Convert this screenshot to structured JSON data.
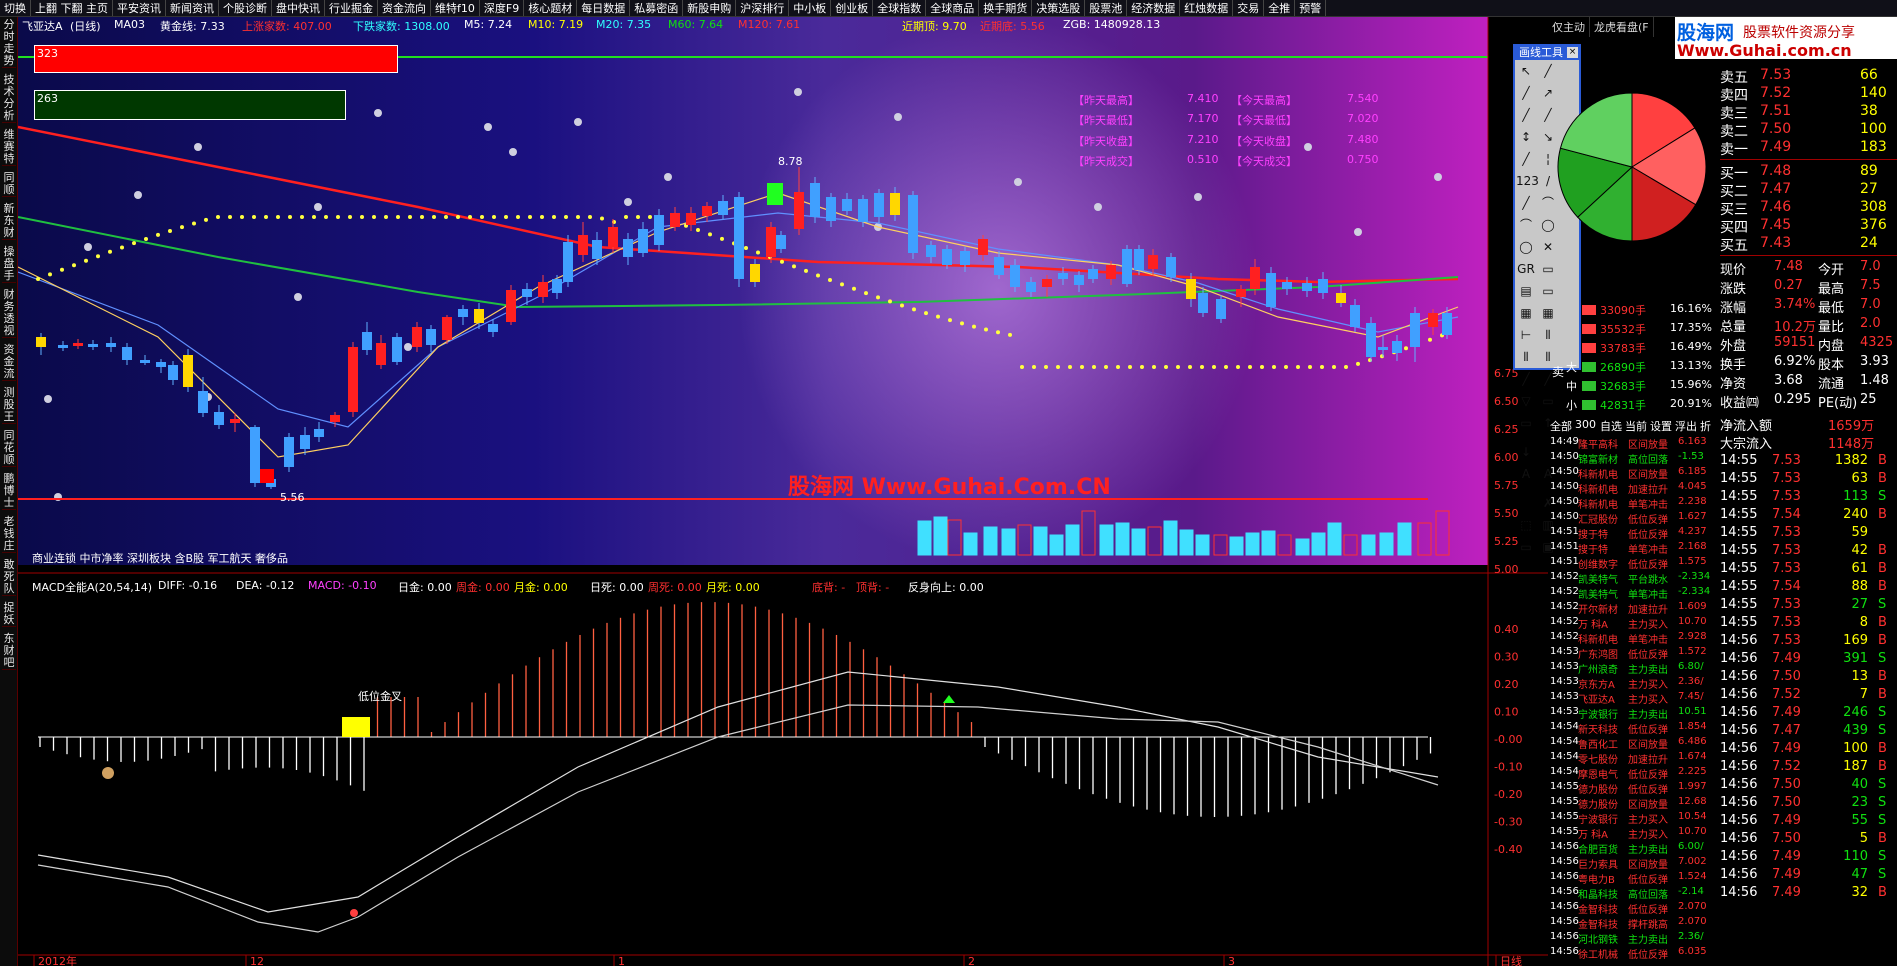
{
  "menubar": [
    "切换",
    "上翻 下翻 主页",
    "平安资讯",
    "新闻资讯",
    "个股诊断",
    "盘中快讯",
    "行业掘金",
    "资金流向",
    "维特f10",
    "深度F9",
    "核心题材",
    "每日数据",
    "私募密函",
    "新股申购",
    "沪深排行",
    "中小板",
    "创业板",
    "全球指数",
    "全球商品",
    "换手期货",
    "决策选股",
    "股票池",
    "经济数据",
    "红烛数据",
    "交易",
    "全推",
    "预警"
  ],
  "sidebar": [
    "分时走势",
    "技术分析",
    "维赛特",
    "同顺",
    "新东财",
    "操盘手",
    "财务透视",
    "资金流",
    "测股王",
    "同花顺",
    "鹏博士",
    "老钱庄",
    "敢死队",
    "捉妖",
    "东财吧"
  ],
  "header": {
    "stock": "飞亚达A",
    "period": "(日线)",
    "ma": "MA03",
    "gold_line": "黄金线: 7.33",
    "up_count": "上涨家数: 407.00",
    "down_count": "下跌家数: 1308.00",
    "m5": "M5: 7.24",
    "m10": "M10: 7.19",
    "m20": "M20: 7.35",
    "m60": "M60: 7.64",
    "m120": "M120: 7.61",
    "near_top": "近期顶: 9.70",
    "near_bottom": "近期底: 5.56",
    "zgb": "ZGB: 1480928.13"
  },
  "bars": {
    "red_value": "323",
    "green_value": "263"
  },
  "info": {
    "y_high_label": "【昨天最高】",
    "y_high": "7.410",
    "y_low_label": "【昨天最低】",
    "y_low": "7.170",
    "y_close_label": "【昨天收盘】",
    "y_close": "7.210",
    "y_vol_label": "【昨天成交】",
    "y_vol": "0.510",
    "t_high_label": "【今天最高】",
    "t_high": "7.540",
    "t_low_label": "【今天最低】",
    "t_low": "7.020",
    "t_close_label": "【今天收盘】",
    "t_close": "7.480",
    "t_vol_label": "【今天成交】",
    "t_vol": "0.750"
  },
  "annotations": {
    "high": "8.78",
    "low": "5.56",
    "watermark": "股海网 Www.Guhai.Com.CN",
    "golden_cross": "低位金叉"
  },
  "concepts": "商业连锁 中市净率 深圳板块 含B股 军工航天 奢侈品",
  "macd_header": {
    "name": "MACD全能A(20,54,14)",
    "diff": "DIFF: -0.16",
    "dea": "DEA: -0.12",
    "macd": "MACD: -0.10",
    "day_gold": "日金: 0.00",
    "week_gold": "周金: 0.00",
    "month_gold": "月金: 0.00",
    "day_dead": "日死: 0.00",
    "week_dead": "周死: 0.00",
    "month_dead": "月死: 0.00",
    "bottom_div": "底背: -",
    "top_div": "顶背: -",
    "rebound": "反身向上: 0.00"
  },
  "price_axis": [
    "6.75",
    "6.50",
    "6.25",
    "6.00",
    "5.75",
    "5.50",
    "5.25",
    "5.00"
  ],
  "macd_axis": [
    "0.40",
    "0.30",
    "0.20",
    "0.10",
    "-0.00",
    "-0.10",
    "-0.20",
    "-0.30",
    "-0.40"
  ],
  "time_axis": [
    "2012年",
    "12",
    "1",
    "2",
    "3",
    "日线"
  ],
  "toolbox": {
    "title": "画线工具",
    "close": "×",
    "glyphs": [
      "↖",
      "╱",
      "╱",
      "↗",
      "╱",
      "╱",
      "↕",
      "↘",
      "╱",
      "¦",
      "123",
      "/",
      "╱",
      "⌒",
      "⌒",
      "◯",
      "◯",
      "✕",
      "GR",
      "▭",
      "▤",
      "▭",
      "▦",
      "▦",
      "⊢",
      "⦀",
      "⦀",
      "⦀",
      "╱",
      "╱",
      "▽",
      "▭",
      "▭",
      "↑",
      "↓",
      "",
      "A",
      "A",
      "",
      "✗",
      "⬚",
      "▥",
      "▭",
      "▣",
      ""
    ]
  },
  "right_tabs": [
    "仅主动",
    "龙虎看盘(F"
  ],
  "logo": {
    "site": "股海网",
    "slogan": "股票软件资源分享",
    "url": "Www.Guhai.com.cn"
  },
  "orderbook": {
    "sells": [
      {
        "label": "卖五",
        "price": "7.53",
        "vol": "66"
      },
      {
        "label": "卖四",
        "price": "7.52",
        "vol": "140"
      },
      {
        "label": "卖三",
        "price": "7.51",
        "vol": "38"
      },
      {
        "label": "卖二",
        "price": "7.50",
        "vol": "100"
      },
      {
        "label": "卖一",
        "price": "7.49",
        "vol": "183"
      }
    ],
    "buys": [
      {
        "label": "买一",
        "price": "7.48",
        "vol": "89"
      },
      {
        "label": "买二",
        "price": "7.47",
        "vol": "27"
      },
      {
        "label": "买三",
        "price": "7.46",
        "vol": "308"
      },
      {
        "label": "买四",
        "price": "7.45",
        "vol": "376"
      },
      {
        "label": "买五",
        "price": "7.43",
        "vol": "24"
      }
    ]
  },
  "quote": [
    {
      "l1": "现价",
      "v1": "7.48",
      "l2": "今开",
      "v2": "7.0"
    },
    {
      "l1": "涨跌",
      "v1": "0.27",
      "l2": "最高",
      "v2": "7.5"
    },
    {
      "l1": "涨幅",
      "v1": "3.74%",
      "l2": "最低",
      "v2": "7.0"
    },
    {
      "l1": "总量",
      "v1": "10.2万",
      "l2": "量比",
      "v2": "2.0"
    },
    {
      "l1": "外盘",
      "v1": "59151",
      "l2": "内盘",
      "v2": "4325"
    },
    {
      "l1": "换手",
      "v1": "6.92%",
      "l2": "股本",
      "v2": "3.93"
    },
    {
      "l1": "净资",
      "v1": "3.68",
      "l2": "流通",
      "v2": "1.48"
    },
    {
      "l1": "收益㈣",
      "v1": "0.295",
      "l2": "PE(动)",
      "v2": "25"
    }
  ],
  "netflow": [
    {
      "label": "净流入额",
      "value": "1659万"
    },
    {
      "label": "大宗流入",
      "value": "1148万"
    }
  ],
  "flow_rows": [
    {
      "label": "",
      "vol": "33090手",
      "pct": "16.16%"
    },
    {
      "label": "",
      "vol": "35532手",
      "pct": "17.35%"
    },
    {
      "label": "",
      "vol": "33783手",
      "pct": "16.49%"
    },
    {
      "label": "大",
      "vol": "26890手",
      "pct": "13.13%"
    },
    {
      "label": "中",
      "vol": "32683手",
      "pct": "15.96%"
    },
    {
      "label": "小",
      "vol": "42831手",
      "pct": "20.91%"
    }
  ],
  "sell_side_label": "卖",
  "pie_chart": {
    "slices": [
      {
        "color": "#ff4040",
        "value": 16.16
      },
      {
        "color": "#ff6060",
        "value": 17.35
      },
      {
        "color": "#d02020",
        "value": 16.49
      },
      {
        "color": "#30b030",
        "value": 13.13
      },
      {
        "color": "#20a020",
        "value": 15.96
      },
      {
        "color": "#60d060",
        "value": 20.91
      }
    ]
  },
  "news_tabs": [
    "全部",
    "300",
    "自选",
    "当前",
    "设置",
    "浮出",
    "折"
  ],
  "news": [
    {
      "t": "14:49",
      "n": "隆平高科",
      "e": "区间放量",
      "v": "6.163"
    },
    {
      "t": "14:50",
      "n": "锦富新材",
      "e": "高位回落",
      "v": "-1.53"
    },
    {
      "t": "14:50",
      "n": "科新机电",
      "e": "区间放量",
      "v": "6.185"
    },
    {
      "t": "14:50",
      "n": "科新机电",
      "e": "加速拉升",
      "v": "4.045"
    },
    {
      "t": "14:50",
      "n": "科新机电",
      "e": "单笔冲击",
      "v": "2.238"
    },
    {
      "t": "14:50",
      "n": "汇冠股份",
      "e": "低位反弹",
      "v": "1.627"
    },
    {
      "t": "14:51",
      "n": "搜于特",
      "e": "低位反弹",
      "v": "4.237"
    },
    {
      "t": "14:51",
      "n": "搜于特",
      "e": "单笔冲击",
      "v": "2.168"
    },
    {
      "t": "14:51",
      "n": "创维数字",
      "e": "低位反弹",
      "v": "1.575"
    },
    {
      "t": "14:52",
      "n": "凯美特气",
      "e": "平台跳水",
      "v": "-2.334"
    },
    {
      "t": "14:52",
      "n": "凯美特气",
      "e": "单笔冲击",
      "v": "-2.334"
    },
    {
      "t": "14:52",
      "n": "开尔新材",
      "e": "加速拉升",
      "v": "1.609"
    },
    {
      "t": "14:52",
      "n": "万 科A",
      "e": "主力买入",
      "v": "10.70"
    },
    {
      "t": "14:52",
      "n": "科新机电",
      "e": "单笔冲击",
      "v": "2.928"
    },
    {
      "t": "14:53",
      "n": "广东鸿图",
      "e": "低位反弹",
      "v": "1.572"
    },
    {
      "t": "14:53",
      "n": "广州浪奇",
      "e": "主力卖出",
      "v": "6.80/"
    },
    {
      "t": "14:53",
      "n": "京东方A",
      "e": "主力买入",
      "v": "2.36/"
    },
    {
      "t": "14:53",
      "n": "飞亚达A",
      "e": "主力买入",
      "v": "7.45/"
    },
    {
      "t": "14:53",
      "n": "宁波银行",
      "e": "主力卖出",
      "v": "10.51"
    },
    {
      "t": "14:54",
      "n": "新天科技",
      "e": "低位反弹",
      "v": "1.854"
    },
    {
      "t": "14:54",
      "n": "鲁西化工",
      "e": "区间放量",
      "v": "6.486"
    },
    {
      "t": "14:54",
      "n": "零七股份",
      "e": "加速拉升",
      "v": "1.674"
    },
    {
      "t": "14:54",
      "n": "摩恩电气",
      "e": "低位反弹",
      "v": "2.225"
    },
    {
      "t": "14:55",
      "n": "德力股份",
      "e": "低位反弹",
      "v": "1.997"
    },
    {
      "t": "14:55",
      "n": "德力股份",
      "e": "区间放量",
      "v": "12.68"
    },
    {
      "t": "14:55",
      "n": "宁波银行",
      "e": "主力买入",
      "v": "10.54"
    },
    {
      "t": "14:55",
      "n": "万 科A",
      "e": "主力买入",
      "v": "10.70"
    },
    {
      "t": "14:56",
      "n": "合肥百货",
      "e": "主力卖出",
      "v": "6.00/"
    },
    {
      "t": "14:56",
      "n": "巨力索具",
      "e": "区间放量",
      "v": "7.002"
    },
    {
      "t": "14:56",
      "n": "粤电力B",
      "e": "低位反弹",
      "v": "1.524"
    },
    {
      "t": "14:56",
      "n": "和晶科技",
      "e": "高位回落",
      "v": "-2.14"
    },
    {
      "t": "14:56",
      "n": "金智科技",
      "e": "低位反弹",
      "v": "2.070"
    },
    {
      "t": "14:56",
      "n": "金智科技",
      "e": "撑杆跳高",
      "v": "2.070"
    },
    {
      "t": "14:56",
      "n": "河北钢铁",
      "e": "主力卖出",
      "v": "2.36/"
    },
    {
      "t": "14:56",
      "n": "徐工机械",
      "e": "低位反弹",
      "v": "6.035"
    }
  ],
  "ticks": [
    {
      "t": "14:55",
      "p": "7.53",
      "v": "1382",
      "s": "B"
    },
    {
      "t": "14:55",
      "p": "7.53",
      "v": "63",
      "s": "B"
    },
    {
      "t": "14:55",
      "p": "7.53",
      "v": "113",
      "s": "S"
    },
    {
      "t": "14:55",
      "p": "7.54",
      "v": "240",
      "s": "B"
    },
    {
      "t": "14:55",
      "p": "7.53",
      "v": "59",
      "s": ""
    },
    {
      "t": "14:55",
      "p": "7.53",
      "v": "42",
      "s": "B"
    },
    {
      "t": "14:55",
      "p": "7.53",
      "v": "61",
      "s": "B"
    },
    {
      "t": "14:55",
      "p": "7.54",
      "v": "88",
      "s": "B"
    },
    {
      "t": "14:55",
      "p": "7.53",
      "v": "27",
      "s": "S"
    },
    {
      "t": "14:55",
      "p": "7.53",
      "v": "8",
      "s": "B"
    },
    {
      "t": "14:56",
      "p": "7.53",
      "v": "169",
      "s": "B"
    },
    {
      "t": "14:56",
      "p": "7.49",
      "v": "391",
      "s": "S"
    },
    {
      "t": "14:56",
      "p": "7.50",
      "v": "13",
      "s": "B"
    },
    {
      "t": "14:56",
      "p": "7.52",
      "v": "7",
      "s": "B"
    },
    {
      "t": "14:56",
      "p": "7.49",
      "v": "246",
      "s": "S"
    },
    {
      "t": "14:56",
      "p": "7.47",
      "v": "439",
      "s": "S"
    },
    {
      "t": "14:56",
      "p": "7.49",
      "v": "100",
      "s": "B"
    },
    {
      "t": "14:56",
      "p": "7.52",
      "v": "187",
      "s": "B"
    },
    {
      "t": "14:56",
      "p": "7.50",
      "v": "40",
      "s": "S"
    },
    {
      "t": "14:56",
      "p": "7.50",
      "v": "23",
      "s": "S"
    },
    {
      "t": "14:56",
      "p": "7.49",
      "v": "55",
      "s": "S"
    },
    {
      "t": "14:56",
      "p": "7.50",
      "v": "5",
      "s": "B"
    },
    {
      "t": "14:56",
      "p": "7.49",
      "v": "110",
      "s": "S"
    },
    {
      "t": "14:56",
      "p": "7.49",
      "v": "47",
      "s": "S"
    },
    {
      "t": "14:56",
      "p": "7.49",
      "v": "32",
      "s": "B"
    }
  ]
}
